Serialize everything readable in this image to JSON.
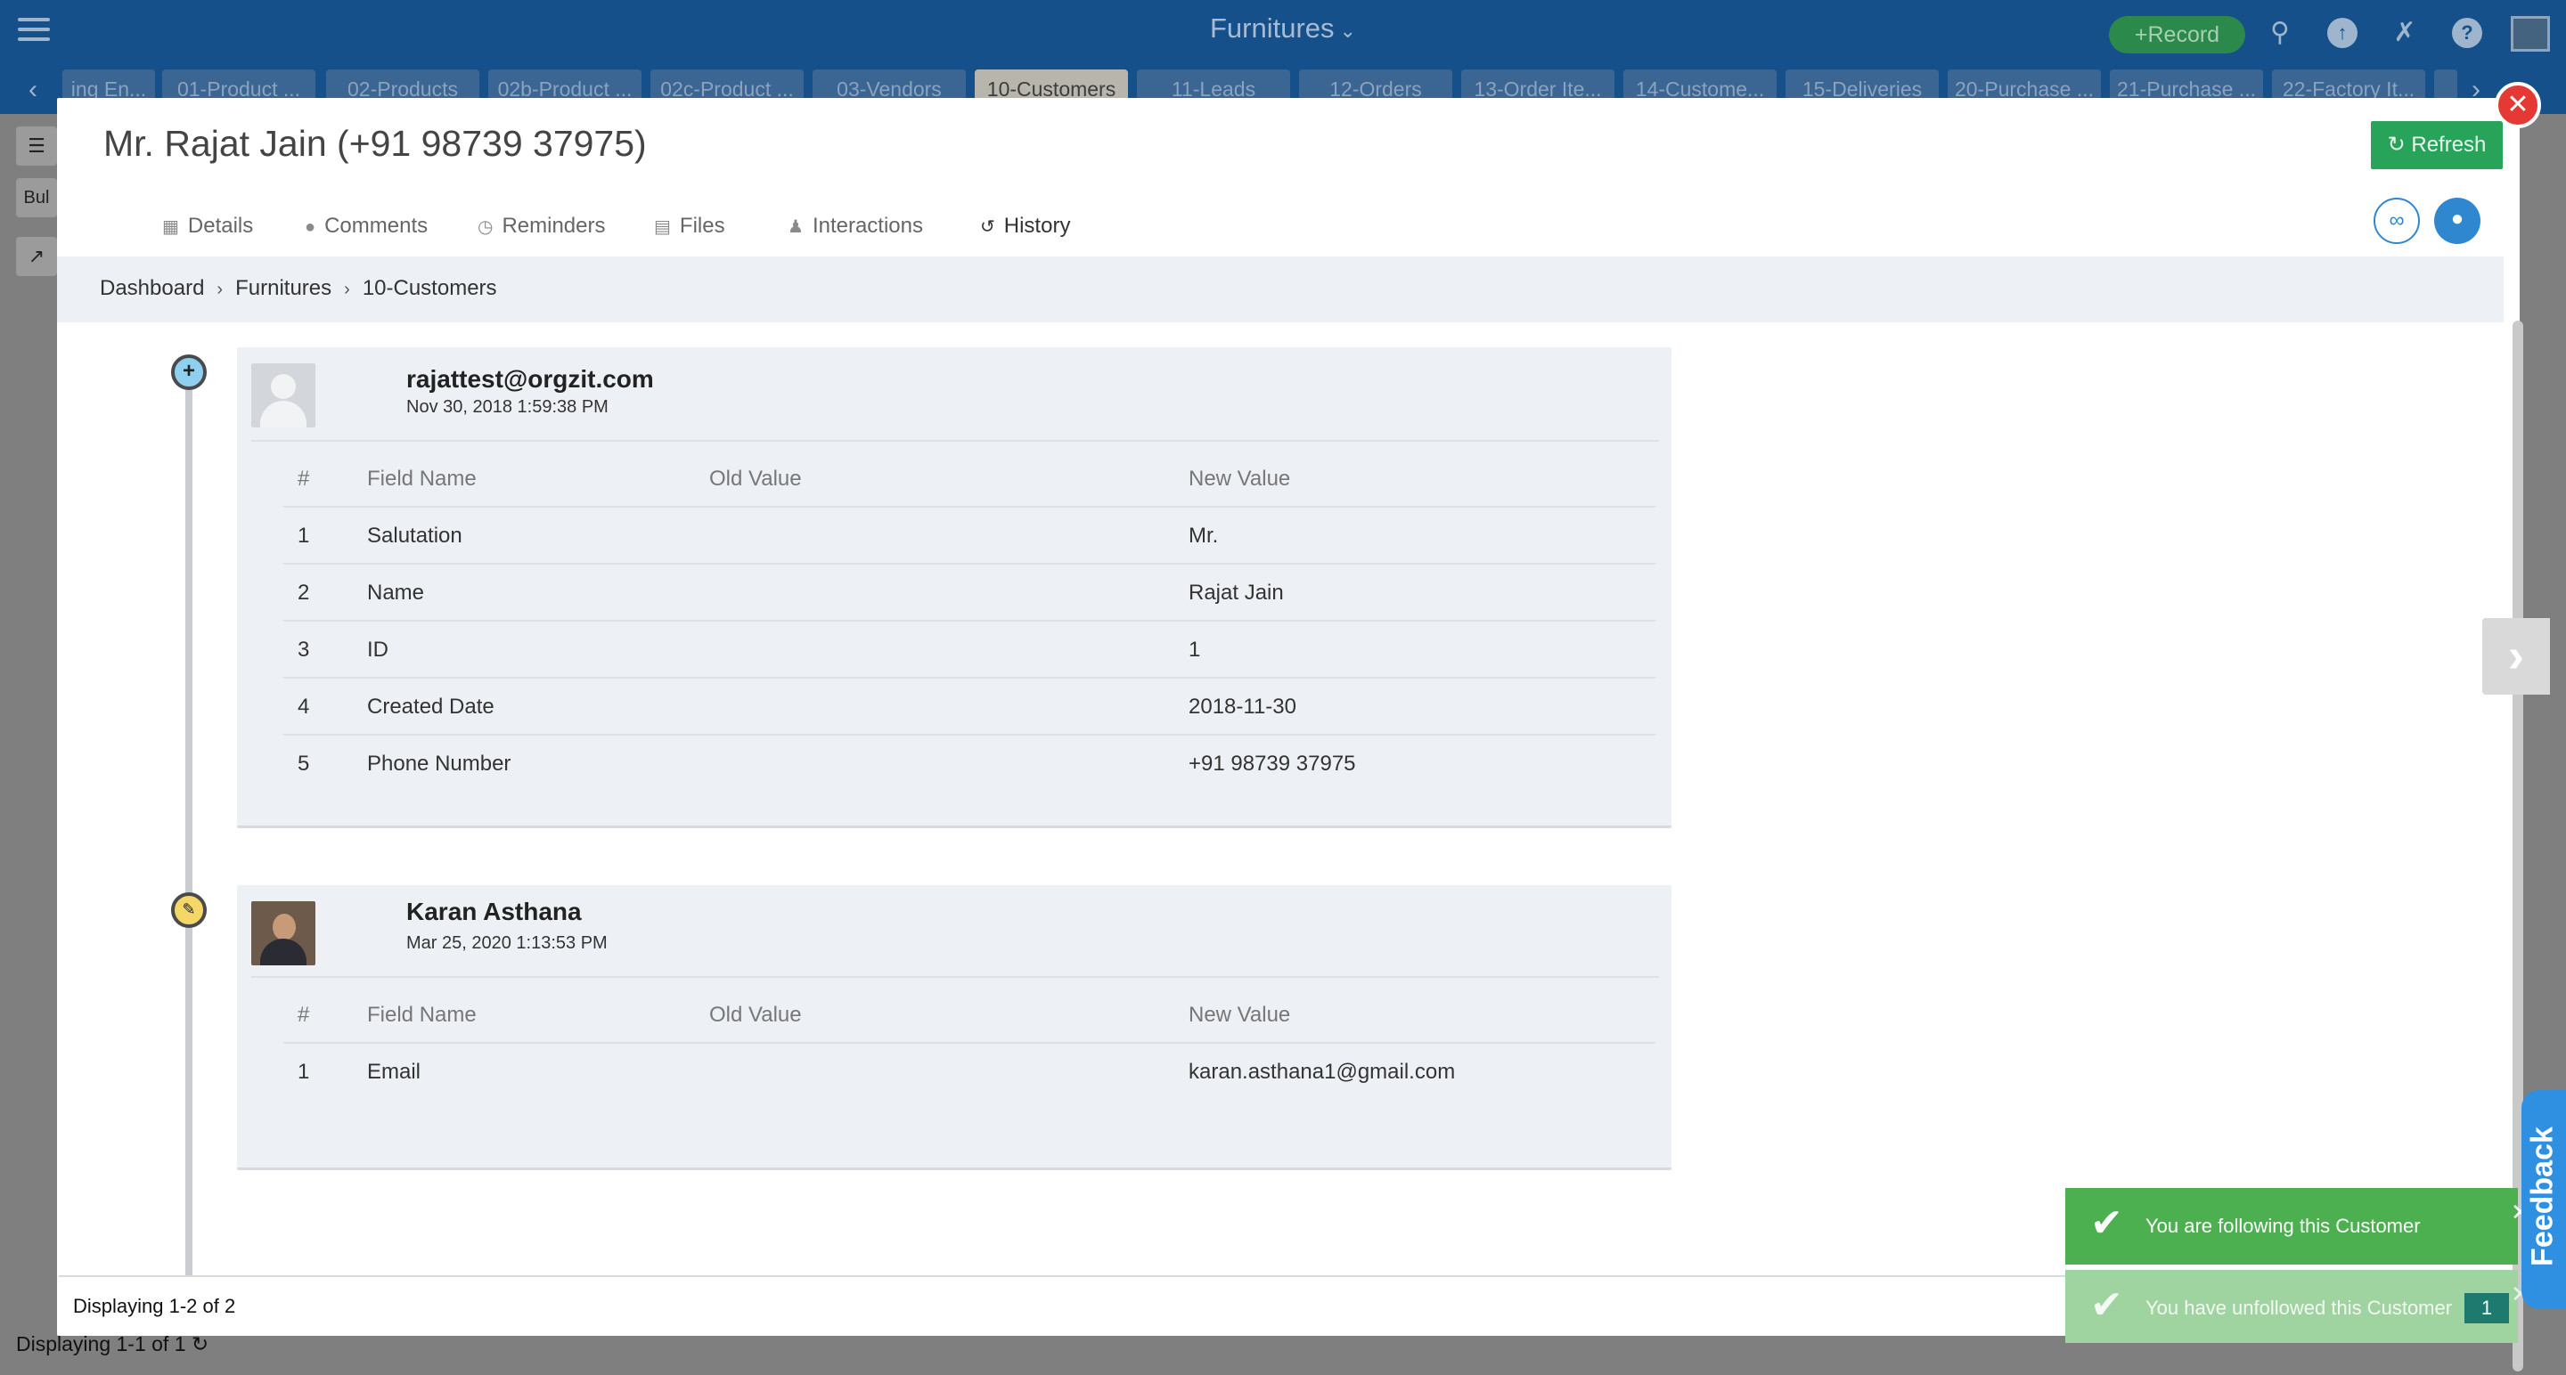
{
  "topbar": {
    "app_title": "Furnitures",
    "record_label": "Record"
  },
  "tabstrip": {
    "tabs": [
      {
        "label": "ing En..."
      },
      {
        "label": "01-Product ..."
      },
      {
        "label": "02-Products"
      },
      {
        "label": "02b-Product ..."
      },
      {
        "label": "02c-Product ..."
      },
      {
        "label": "03-Vendors"
      },
      {
        "label": "10-Customers"
      },
      {
        "label": "11-Leads"
      },
      {
        "label": "12-Orders"
      },
      {
        "label": "13-Order Ite..."
      },
      {
        "label": "14-Custome..."
      },
      {
        "label": "15-Deliveries"
      },
      {
        "label": "20-Purchase ..."
      },
      {
        "label": "21-Purchase ..."
      },
      {
        "label": "22-Factory It..."
      }
    ],
    "active": "10-Customers"
  },
  "background": {
    "left_label": "Bul",
    "footer_text": "Displaying 1-1 of 1"
  },
  "modal": {
    "title": "Mr. Rajat Jain (+91 98739 37975)",
    "refresh_label": "Refresh",
    "tabs": [
      {
        "label": "Details",
        "icon": "table-icon"
      },
      {
        "label": "Comments",
        "icon": "comments-icon"
      },
      {
        "label": "Reminders",
        "icon": "clock-icon"
      },
      {
        "label": "Files",
        "icon": "file-icon"
      },
      {
        "label": "Interactions",
        "icon": "user-icon"
      },
      {
        "label": "History",
        "icon": "history-icon"
      }
    ],
    "active_tab": "History",
    "breadcrumb": [
      "Dashboard",
      "Furnitures",
      "10-Customers"
    ],
    "footer_text": "Displaying 1-2 of 2"
  },
  "history": {
    "columns": {
      "num": "#",
      "field": "Field Name",
      "old": "Old Value",
      "new": "New Value"
    },
    "entries": [
      {
        "type": "create",
        "author": "rajattest@orgzit.com",
        "timestamp": "Nov 30, 2018 1:59:38 PM",
        "rows": [
          {
            "num": "1",
            "field": "Salutation",
            "old": "",
            "new": "Mr."
          },
          {
            "num": "2",
            "field": "Name",
            "old": "",
            "new": "Rajat Jain"
          },
          {
            "num": "3",
            "field": "ID",
            "old": "",
            "new": "1"
          },
          {
            "num": "4",
            "field": "Created Date",
            "old": "",
            "new": "2018-11-30"
          },
          {
            "num": "5",
            "field": "Phone Number",
            "old": "",
            "new": "+91 98739 37975"
          }
        ]
      },
      {
        "type": "edit",
        "author": "Karan Asthana",
        "timestamp": "Mar 25, 2020 1:13:53 PM",
        "rows": [
          {
            "num": "1",
            "field": "Email",
            "old": "",
            "new": "karan.asthana1@gmail.com"
          }
        ]
      }
    ]
  },
  "feedback_label": "Feedback",
  "toasts": [
    {
      "message": "You are following this Customer"
    },
    {
      "message": "You have unfollowed this Customer",
      "count": "1"
    }
  ],
  "colors": {
    "topbar": "#15508a",
    "accent_tab": "#2bb5c9",
    "refresh": "#27a35a",
    "close": "#e53935",
    "toast": "#4caf50",
    "feedback": "#2f8fe0"
  }
}
